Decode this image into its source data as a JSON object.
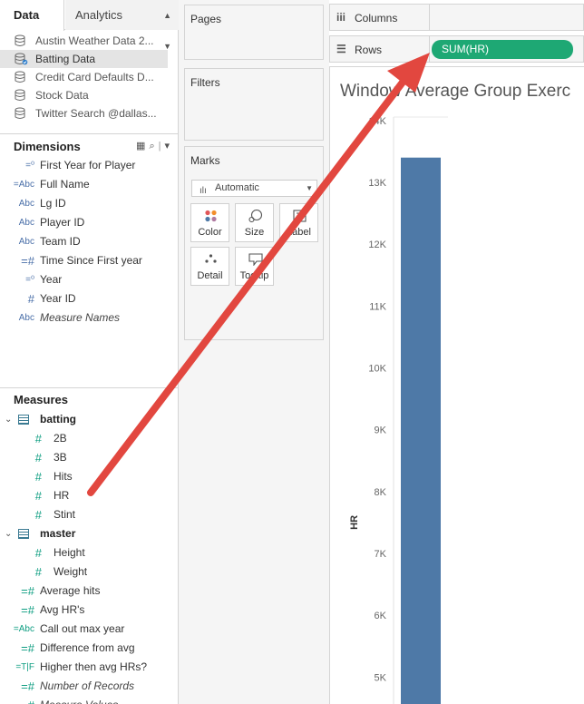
{
  "tabs": {
    "data": "Data",
    "analytics": "Analytics"
  },
  "data_sources": [
    {
      "label": "Austin Weather Data 2...",
      "selected": false
    },
    {
      "label": "Batting Data",
      "selected": true
    },
    {
      "label": "Credit Card Defaults D...",
      "selected": false
    },
    {
      "label": "Stock Data",
      "selected": false
    },
    {
      "label": "Twitter Search @dallas...",
      "selected": false
    }
  ],
  "dimensions": {
    "title": "Dimensions",
    "items": [
      {
        "icon": "calendar-icon",
        "type": "=⁰",
        "label": "First Year for Player"
      },
      {
        "icon": "abc-icon",
        "type": "=Abc",
        "label": "Full Name"
      },
      {
        "icon": "abc-icon",
        "type": "Abc",
        "label": "Lg ID"
      },
      {
        "icon": "abc-icon",
        "type": "Abc",
        "label": "Player ID"
      },
      {
        "icon": "abc-icon",
        "type": "Abc",
        "label": "Team ID"
      },
      {
        "icon": "number-icon",
        "type": "=#",
        "label": "Time Since First year"
      },
      {
        "icon": "calendar-icon",
        "type": "=⁰",
        "label": "Year"
      },
      {
        "icon": "number-icon",
        "type": "#",
        "label": "Year ID"
      },
      {
        "icon": "abc-icon",
        "type": "Abc",
        "label": "Measure Names"
      }
    ]
  },
  "measures": {
    "title": "Measures",
    "groups": [
      {
        "label": "batting",
        "children": [
          "2B",
          "3B",
          "Hits",
          "HR",
          "Stint"
        ]
      },
      {
        "label": "master",
        "children": [
          "Height",
          "Weight"
        ]
      }
    ],
    "items": [
      {
        "type": "=#",
        "label": "Average hits"
      },
      {
        "type": "=#",
        "label": "Avg HR's"
      },
      {
        "type": "=Abc",
        "label": "Call out max year"
      },
      {
        "type": "=#",
        "label": "Difference from avg"
      },
      {
        "type": "=T|F",
        "label": "Higher then avg HRs?"
      },
      {
        "type": "=#",
        "label": "Number of Records"
      },
      {
        "type": "#",
        "label": "Measure Values"
      }
    ]
  },
  "cards": {
    "pages": "Pages",
    "filters": "Filters",
    "marks": "Marks",
    "mark_type": "Automatic",
    "buttons": {
      "color": "Color",
      "size": "Size",
      "label": "Label",
      "detail": "Detail",
      "tooltip": "Tooltip"
    }
  },
  "shelves": {
    "columns": "Columns",
    "rows": "Rows",
    "rows_pill": "SUM(HR)"
  },
  "sheet": {
    "title": "Window Average Group Exerc"
  },
  "chart_data": {
    "type": "bar",
    "title": "Window Average Group Exerc",
    "ylabel": "HR",
    "ylim": [
      4.55,
      14.1
    ],
    "yticks": [
      "14K",
      "13K",
      "12K",
      "11K",
      "10K",
      "9K",
      "8K",
      "7K",
      "6K",
      "5K"
    ],
    "ytick_values": [
      14,
      13,
      12,
      11,
      10,
      9,
      8,
      7,
      6,
      5
    ],
    "values": [
      13.4
    ],
    "bar_color": "#4e79a7"
  },
  "colors": {
    "accent_pill": "#1ea874",
    "arrow": "#e2473f",
    "bar": "#4e79a7"
  }
}
